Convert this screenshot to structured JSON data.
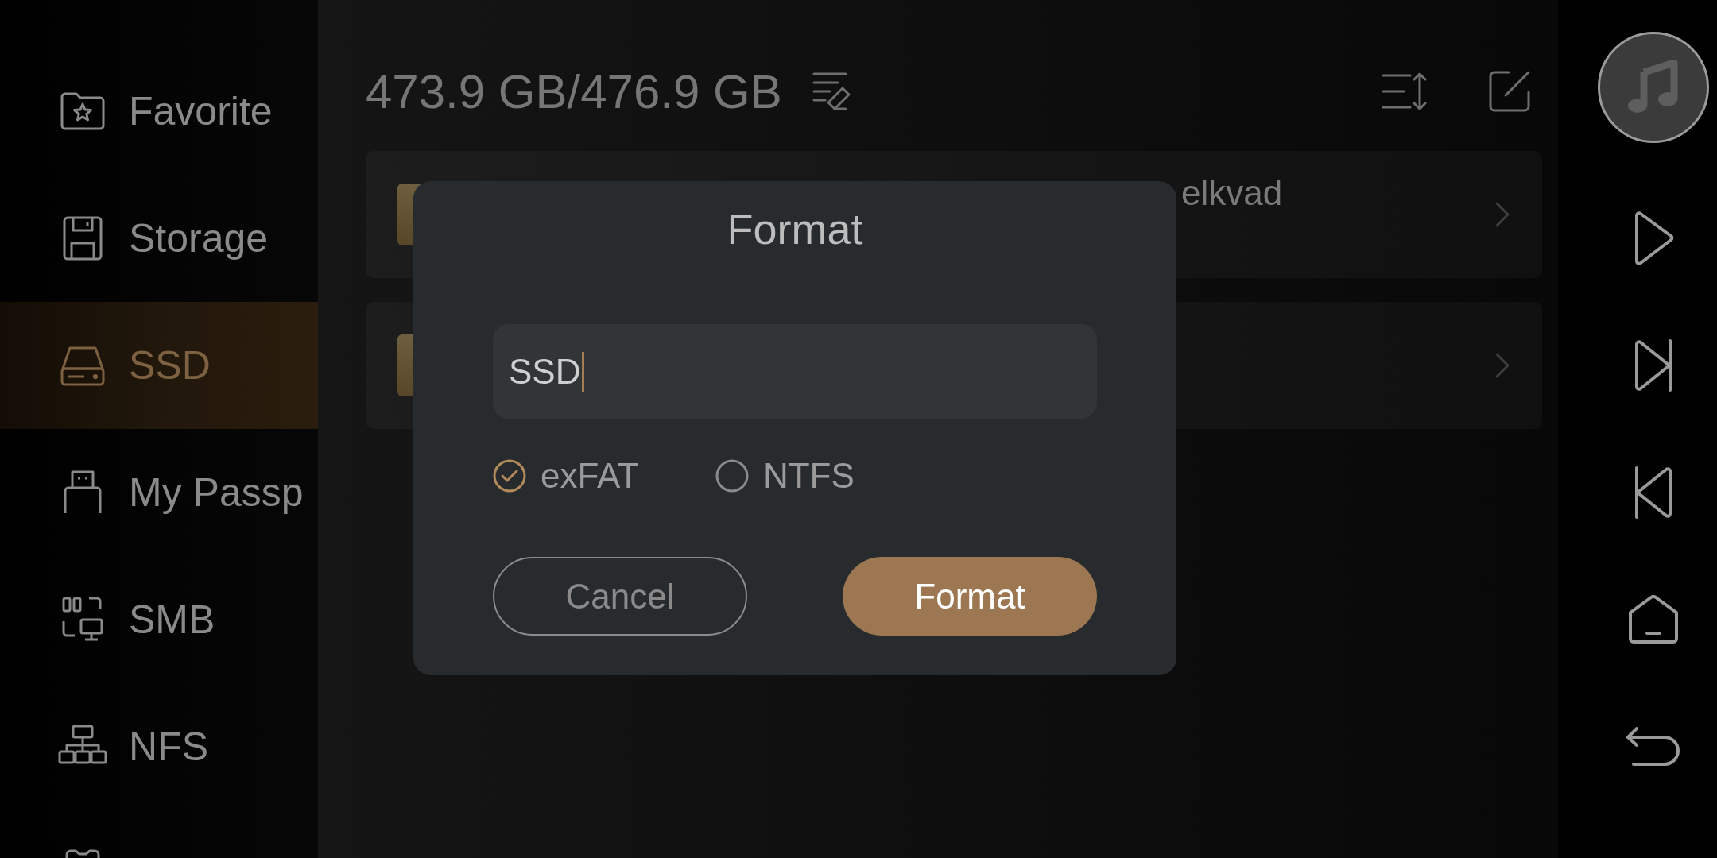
{
  "sidebar": {
    "items": [
      {
        "kind": "favorites",
        "label": "Favorite",
        "selected": false
      },
      {
        "kind": "storage",
        "label": "Storage",
        "selected": false
      },
      {
        "kind": "drive",
        "label": "SSD",
        "selected": true
      },
      {
        "kind": "usb",
        "label": "My Passp",
        "selected": false
      },
      {
        "kind": "smb",
        "label": "SMB",
        "selected": false
      },
      {
        "kind": "nfs",
        "label": "NFS",
        "selected": false
      },
      {
        "kind": "partial",
        "selected": false
      }
    ]
  },
  "header": {
    "storage_usage": "473.9 GB/476.9 GB"
  },
  "rows": [
    {
      "kind": "folder",
      "name": "elkvad"
    },
    {
      "kind": "folder"
    }
  ],
  "dialog": {
    "title": "Format",
    "name_field": {
      "value": "SSD"
    },
    "options": [
      {
        "label": "exFAT",
        "selected": true
      },
      {
        "label": "NTFS",
        "selected": false
      }
    ],
    "buttons": [
      {
        "kind": "secondary",
        "label": "Cancel"
      },
      {
        "kind": "primary",
        "label": "Format"
      }
    ]
  }
}
